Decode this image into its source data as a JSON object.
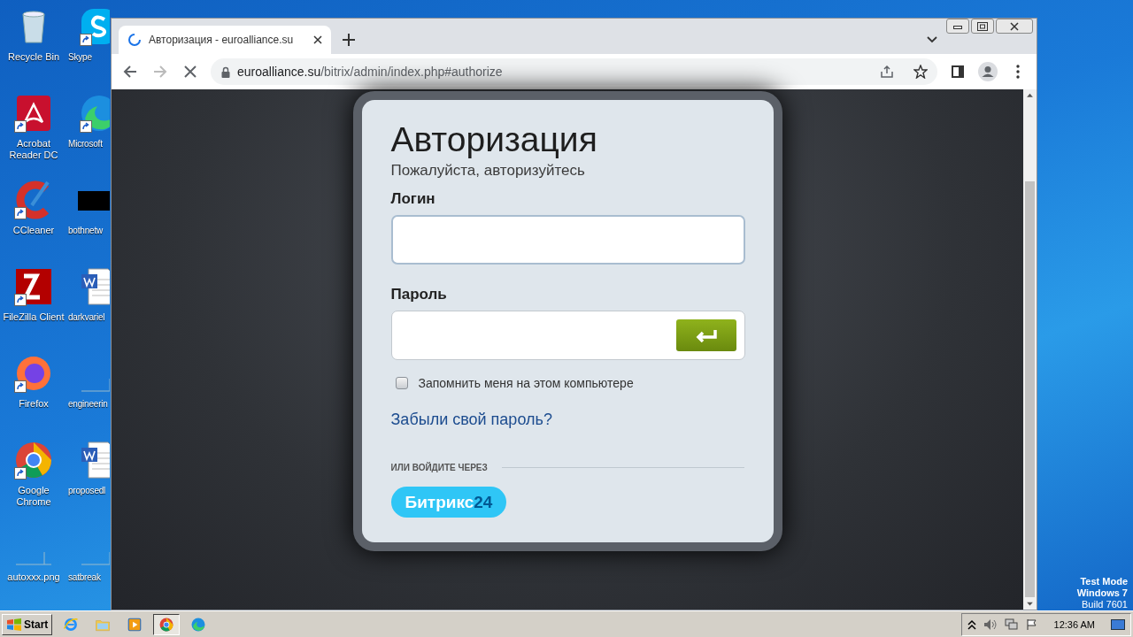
{
  "desktop": {
    "columns": [
      [
        {
          "label": "Recycle Bin",
          "kind": "recycle-bin",
          "shortcut": false
        },
        {
          "label": "Acrobat Reader DC",
          "kind": "acrobat",
          "shortcut": true
        },
        {
          "label": "CCleaner",
          "kind": "ccleaner",
          "shortcut": true
        },
        {
          "label": "FileZilla Client",
          "kind": "filezilla",
          "shortcut": true
        },
        {
          "label": "Firefox",
          "kind": "firefox",
          "shortcut": true
        },
        {
          "label": "Google Chrome",
          "kind": "chrome",
          "shortcut": true
        },
        {
          "label": "autoxxx.png",
          "kind": "blank",
          "shortcut": false
        }
      ],
      [
        {
          "label": "Skype",
          "kind": "skype",
          "shortcut": true
        },
        {
          "label": "Microsoft",
          "kind": "edge",
          "shortcut": true
        },
        {
          "label": "bothnetw",
          "kind": "black",
          "shortcut": false
        },
        {
          "label": "darkvariel",
          "kind": "word",
          "shortcut": false
        },
        {
          "label": "engineerin",
          "kind": "blank",
          "shortcut": false
        },
        {
          "label": "proposedl",
          "kind": "word",
          "shortcut": false
        },
        {
          "label": "satbreak",
          "kind": "blank",
          "shortcut": false
        }
      ]
    ],
    "os_notice": [
      "Test Mode",
      "Windows 7",
      "Build 7601"
    ]
  },
  "browser": {
    "tabs": [
      {
        "title": "Авторизация - euroalliance.su",
        "selected": true,
        "loading": true
      }
    ],
    "back": {
      "disabled": false
    },
    "forward": {
      "disabled": true
    },
    "address": {
      "host": "euroalliance.su",
      "path": "/bitrix/admin/index.php#authorize"
    }
  },
  "form": {
    "title": "Авторизация",
    "subtitle": "Пожалуйста, авторизуйтесь",
    "fields": [
      {
        "label": "Логин",
        "kind": "text"
      },
      {
        "label": "Пароль",
        "kind": "password"
      }
    ],
    "remember": {
      "label": "Запомнить меня на этом компьютере",
      "checked": false
    },
    "forgot_link": "Забыли свой пароль?",
    "divider_label": "ИЛИ ВОЙДИТЕ ЧЕРЕЗ",
    "social": [
      {
        "name": "Битрикс",
        "suffix": "24"
      }
    ]
  },
  "taskbar": {
    "start": "Start",
    "apps": [
      {
        "kind": "ie",
        "selected": false
      },
      {
        "kind": "explorer",
        "selected": false
      },
      {
        "kind": "media",
        "selected": false
      },
      {
        "kind": "chrome",
        "selected": true
      },
      {
        "kind": "edge",
        "selected": false
      }
    ],
    "clock": "12:36 AM"
  }
}
